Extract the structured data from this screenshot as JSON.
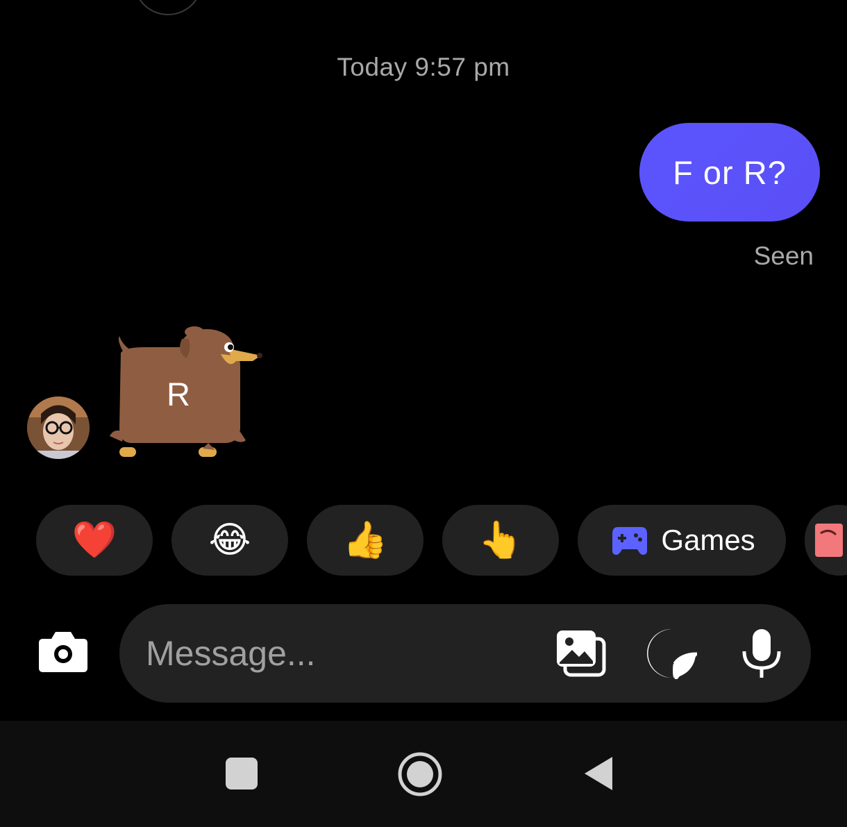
{
  "thread": {
    "timestamp": "Today 9:57 pm",
    "outgoing_message": "F or R?",
    "seen_status": "Seen",
    "incoming_sticker": {
      "icon": "dog-sticker-icon",
      "letter": "R"
    }
  },
  "quick_reactions": [
    {
      "icon": "red-heart-emoji",
      "glyph": "❤️"
    },
    {
      "icon": "laughing-tears-emoji",
      "glyph": "😂"
    },
    {
      "icon": "thumbs-up-emoji",
      "glyph": "👍"
    },
    {
      "icon": "pointing-hand-emoji",
      "glyph": "👆"
    }
  ],
  "games_chip": {
    "label": "Games",
    "icon": "gamepad-icon"
  },
  "composer": {
    "placeholder": "Message..."
  },
  "colors": {
    "background": "#000000",
    "bubble": "#5b55ff",
    "chip": "#222222",
    "muted_text": "#a9a9a9"
  }
}
